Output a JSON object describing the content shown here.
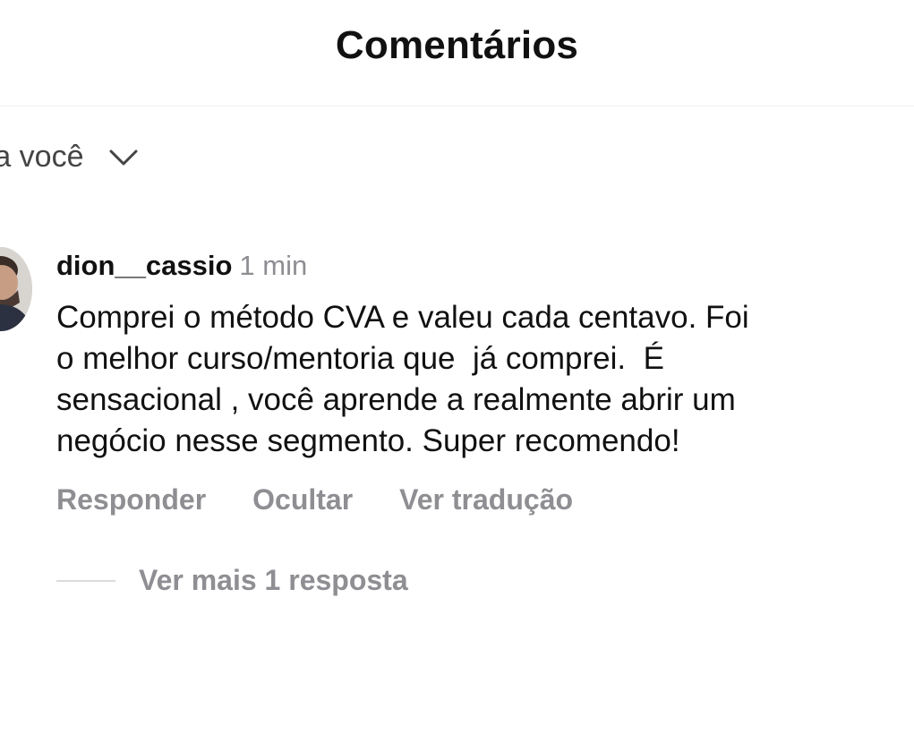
{
  "header": {
    "title": "Comentários"
  },
  "filter": {
    "label": "ra você",
    "icon": "chevron-down-icon"
  },
  "comment": {
    "username": "dion__cassio",
    "time": "1 min",
    "text": "Comprei o método CVA e valeu cada centavo. Foi\no melhor curso/mentoria que  já comprei.  É\nsensacional , você aprende a realmente abrir um\nnegócio nesse segmento. Super recomendo!",
    "actions": {
      "reply": "Responder",
      "hide": "Ocultar",
      "translate": "Ver tradução"
    },
    "more_replies": "Ver mais 1 resposta"
  },
  "colors": {
    "text_primary": "#111111",
    "text_secondary": "#8e8e93",
    "divider": "#dbdbdb"
  }
}
